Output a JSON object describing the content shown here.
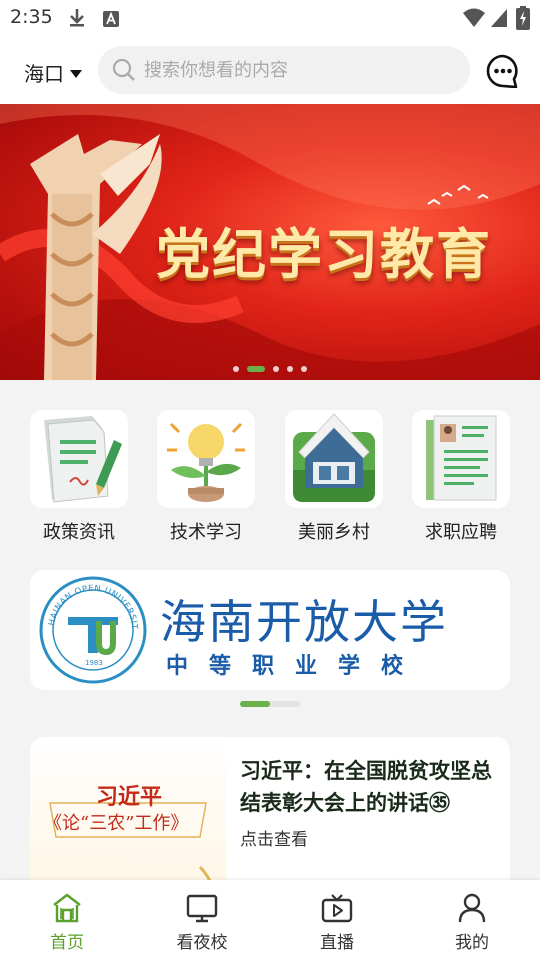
{
  "status_bar": {
    "time": "2:35"
  },
  "header": {
    "city": "海口",
    "search_placeholder": "搜索你想看的内容"
  },
  "banner": {
    "title": "党纪学习教育",
    "slide_count": 5,
    "active_slide": 1
  },
  "quick_menu": [
    {
      "label": "政策资讯",
      "icon": "policy-document-icon"
    },
    {
      "label": "技术学习",
      "icon": "lightbulb-plant-icon"
    },
    {
      "label": "美丽乡村",
      "icon": "house-icon"
    },
    {
      "label": "求职应聘",
      "icon": "resume-icon"
    }
  ],
  "university": {
    "name": "海南开放大学",
    "subtitle": "中等职业学校",
    "logo_text": "HAINAN OPEN UNIVERSITY",
    "logo_year": "1983"
  },
  "news": {
    "title": "习近平：在全国脱贫攻坚总结表彰大会上的讲话㉟",
    "subtitle": "点击查看",
    "thumb_name": "习近平",
    "thumb_title": "《论“三农”工作》"
  },
  "bottom_nav": [
    {
      "label": "首页",
      "icon": "home-icon",
      "active": true
    },
    {
      "label": "看夜校",
      "icon": "monitor-icon",
      "active": false
    },
    {
      "label": "直播",
      "icon": "live-tv-icon",
      "active": false
    },
    {
      "label": "我的",
      "icon": "user-icon",
      "active": false
    }
  ],
  "colors": {
    "accent": "#5aa02c",
    "banner_red": "#e02418",
    "university_blue": "#1a5ca8"
  }
}
